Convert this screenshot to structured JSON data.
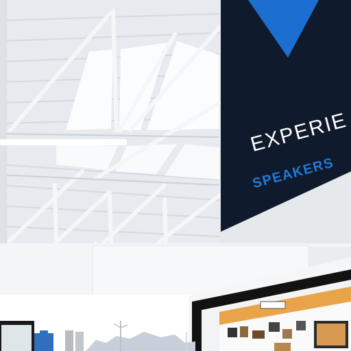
{
  "banner": {
    "line1": "EXPERIE",
    "line2": "SPEAKERS"
  },
  "colors": {
    "ceiling": "#e6e9ec",
    "skylight": "#fbfcfd",
    "banner_bg": "#0f1a2c",
    "banner_logo": "#1c6fd1",
    "banner_text": "#ffffff",
    "banner_accent": "#1f7bd6",
    "booth_frame": "#121212",
    "booth_accent": "#e9a44a"
  }
}
